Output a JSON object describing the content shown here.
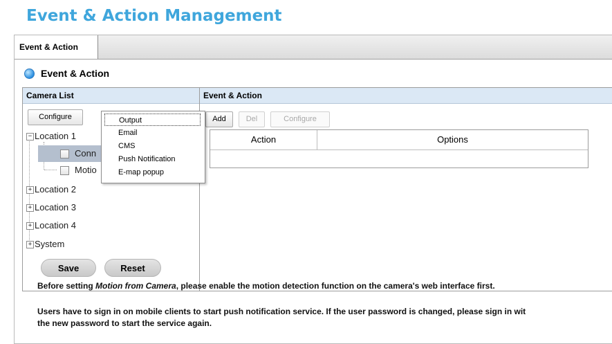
{
  "page_title": "Event & Action Management",
  "tabs": [
    {
      "label": "Event & Action",
      "active": true
    }
  ],
  "section_title": "Event & Action",
  "camera_list": {
    "header": "Camera List",
    "configure_label": "Configure",
    "tree": [
      {
        "label": "Location 1",
        "expanded": true,
        "children": [
          {
            "label": "Conn",
            "selected": true
          },
          {
            "label": "Motio"
          }
        ]
      },
      {
        "label": "Location 2",
        "expanded": false
      },
      {
        "label": "Location 3",
        "expanded": false
      },
      {
        "label": "Location 4",
        "expanded": false
      },
      {
        "label": "System",
        "expanded": false
      }
    ]
  },
  "event_action": {
    "header": "Event & Action",
    "add_label": "Add",
    "del_label": "Del",
    "configure_label": "Configure",
    "columns": [
      "Action",
      "Options"
    ]
  },
  "configure_menu": {
    "items": [
      "Output",
      "Email",
      "CMS",
      "Push Notification",
      "E-map popup"
    ],
    "focused": "Output"
  },
  "footer": {
    "save_label": "Save",
    "reset_label": "Reset",
    "note1_before": "Before setting ",
    "note1_italic": "Motion from Camera",
    "note1_after": ", please enable the motion detection function on the camera's web interface first.",
    "note2_line1": "Users have to sign in on mobile clients to start push notification service. If the user password is changed, please sign in wit",
    "note2_line2": "the new password to start the service again."
  },
  "colors": {
    "title": "#3fa6dc",
    "header_bg": "#dbe8f5",
    "selected_row": "#b4bfce"
  }
}
